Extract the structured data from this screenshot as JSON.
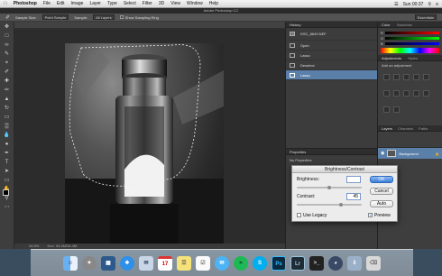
{
  "menubar": {
    "app": "Photoshop",
    "items": [
      "File",
      "Edit",
      "Image",
      "Layer",
      "Type",
      "Select",
      "Filter",
      "3D",
      "View",
      "Window",
      "Help"
    ],
    "clock": "Sun 00:37",
    "wifi_icon": "wifi-icon",
    "search_icon": "search-icon"
  },
  "window_title": "Adobe Photoshop CC",
  "options": {
    "sample_size_label": "Sample Size:",
    "sample_size_value": "Point Sample",
    "sample_label": "Sample:",
    "sample_value": "All Layers",
    "show_ring_label": "Show Sampling Ring",
    "workspace": "Essentials"
  },
  "document": {
    "tab_label": "DSC_8649.NEF @ 34.8% (RGB/16*)",
    "zoom": "34.8%",
    "doc_info": "Doc: 34.4M/34.4M"
  },
  "history": {
    "tab": "History",
    "snapshot": "DSC_8649.NEF",
    "steps": [
      "Open",
      "Lasso",
      "Deselect",
      "Lasso"
    ]
  },
  "properties": {
    "tab": "Properties",
    "empty": "No Properties"
  },
  "right": {
    "color_tab": "Color",
    "swatches_tab": "Swatches",
    "adjustments_tab": "Adjustments",
    "styles_tab": "Styles",
    "add_adjustment": "Add an adjustment",
    "layers_tab": "Layers",
    "channels_tab": "Channels",
    "paths_tab": "Paths",
    "layer_name": "Background"
  },
  "dialog": {
    "title": "Brightness/Contrast",
    "brightness_label": "Brightness:",
    "brightness_value": "",
    "contrast_label": "Contrast:",
    "contrast_value": "45",
    "ok": "OK",
    "cancel": "Cancel",
    "auto": "Auto",
    "legacy": "Use Legacy",
    "preview": "Preview",
    "preview_checked": true,
    "legacy_checked": false
  },
  "dock": {
    "apps": [
      "finder-icon",
      "launchpad-icon",
      "mission-control-icon",
      "safari-icon",
      "mail-icon",
      "calendar-icon",
      "notes-icon",
      "reminders-icon",
      "messages-icon",
      "spotify-icon",
      "skype-icon",
      "photoshop-icon",
      "lightroom-icon",
      "terminal-icon",
      "dashboard-icon",
      "downloads-icon",
      "trash-icon"
    ],
    "calendar_day": "17",
    "photoshop_label": "Ps",
    "lightroom_label": "Lr"
  },
  "colors": {
    "selection": "#5a7fa8",
    "ok_button": "#3b7fd6"
  }
}
